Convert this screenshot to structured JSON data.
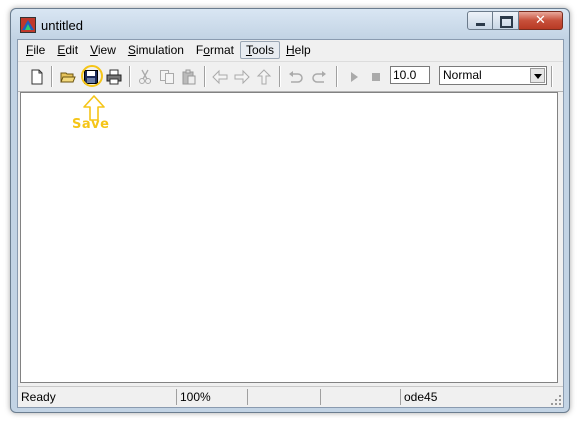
{
  "window": {
    "title": "untitled"
  },
  "menu": {
    "items": [
      {
        "key": "F",
        "rest": "ile"
      },
      {
        "key": "E",
        "rest": "dit"
      },
      {
        "key": "V",
        "rest": "iew"
      },
      {
        "key": "S",
        "rest": "imulation"
      },
      {
        "key": "o",
        "pre": "F",
        "rest": "rmat"
      },
      {
        "key": "T",
        "rest": "ools"
      },
      {
        "key": "H",
        "rest": "elp"
      }
    ]
  },
  "toolbar": {
    "stop_time": "10.0",
    "sim_mode": "Normal",
    "icons": [
      "new-icon",
      "open-icon",
      "save-icon",
      "print-icon",
      "cut-icon",
      "copy-icon",
      "paste-icon",
      "back-icon",
      "forward-icon",
      "up-icon",
      "undo-icon",
      "redo-icon",
      "start-icon",
      "stop-icon"
    ]
  },
  "annotation": {
    "label": "Save",
    "color": "#f5c518"
  },
  "status": {
    "state": "Ready",
    "zoom": "100%",
    "solver": "ode45"
  }
}
